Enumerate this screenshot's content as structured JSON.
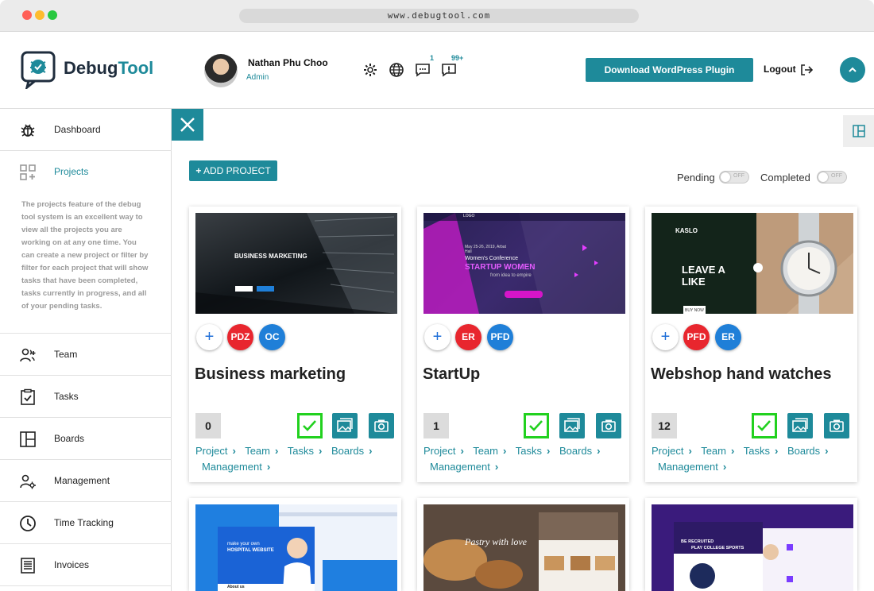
{
  "browser": {
    "url": "www.debugtool.com"
  },
  "header": {
    "logo_prefix": "Debug",
    "logo_suffix": "Tool",
    "user_name": "Nathan Phu Choo",
    "user_role": "Admin",
    "chat_count": "1",
    "alert_count": "99+",
    "download_label": "Download WordPress Plugin",
    "logout_label": "Logout",
    "accent_color": "#1e8a9a"
  },
  "sidebar": {
    "items": [
      {
        "label": "Dashboard",
        "icon": "bug-icon"
      },
      {
        "label": "Projects",
        "icon": "grid-add-icon"
      },
      {
        "label": "Team",
        "icon": "team-add-icon"
      },
      {
        "label": "Tasks",
        "icon": "clipboard-check-icon"
      },
      {
        "label": "Boards",
        "icon": "boards-icon"
      },
      {
        "label": "Management",
        "icon": "user-gear-icon"
      },
      {
        "label": "Time Tracking",
        "icon": "clock-icon"
      },
      {
        "label": "Invoices",
        "icon": "invoice-icon"
      }
    ],
    "projects_description": "The projects feature of the debug tool system is an excellent way to view all the projects you are working on at any one time. You can create a new project or filter by filter for each project that will show tasks that have been completed, tasks currently in progress, and all of your pending tasks."
  },
  "toolbar": {
    "add_project": "ADD PROJECT",
    "filters": [
      {
        "label": "Pending",
        "state": "OFF"
      },
      {
        "label": "Completed",
        "state": "OFF"
      }
    ]
  },
  "projects": [
    {
      "title": "Business marketing",
      "count": "0",
      "members": [
        "PDZ",
        "OC"
      ],
      "thumb": {
        "heading": "BUSINESS MARKETING"
      },
      "links": [
        "Project",
        "Team",
        "Tasks",
        "Boards",
        "Management"
      ]
    },
    {
      "title": "StartUp",
      "count": "1",
      "members": [
        "ER",
        "PFD"
      ],
      "thumb": {
        "logo": "LOGO",
        "date": "May 25-26, 2019, Arbat Hall",
        "line1": "Women's Conference",
        "line2": "STARTUP WOMEN",
        "line3": "from idea to empire"
      },
      "links": [
        "Project",
        "Team",
        "Tasks",
        "Boards",
        "Management"
      ]
    },
    {
      "title": "Webshop hand watches",
      "count": "12",
      "members": [
        "PFD",
        "ER"
      ],
      "thumb": {
        "brand": "KASLO",
        "heading1": "LEAVE A",
        "heading2": "LIKE",
        "buy": "BUY NOW"
      },
      "links": [
        "Project",
        "Team",
        "Tasks",
        "Boards",
        "Management"
      ]
    }
  ],
  "preview_cards": [
    {
      "thumb": {
        "line1": "make your own",
        "line2": "HOSPITAL WEBSITE",
        "about": "About us"
      }
    },
    {
      "thumb": {
        "line1": "Pastry with love"
      }
    },
    {
      "thumb": {
        "line1": "BE RECRUITED",
        "line2": "PLAY COLLEGE SPORTS"
      }
    }
  ]
}
